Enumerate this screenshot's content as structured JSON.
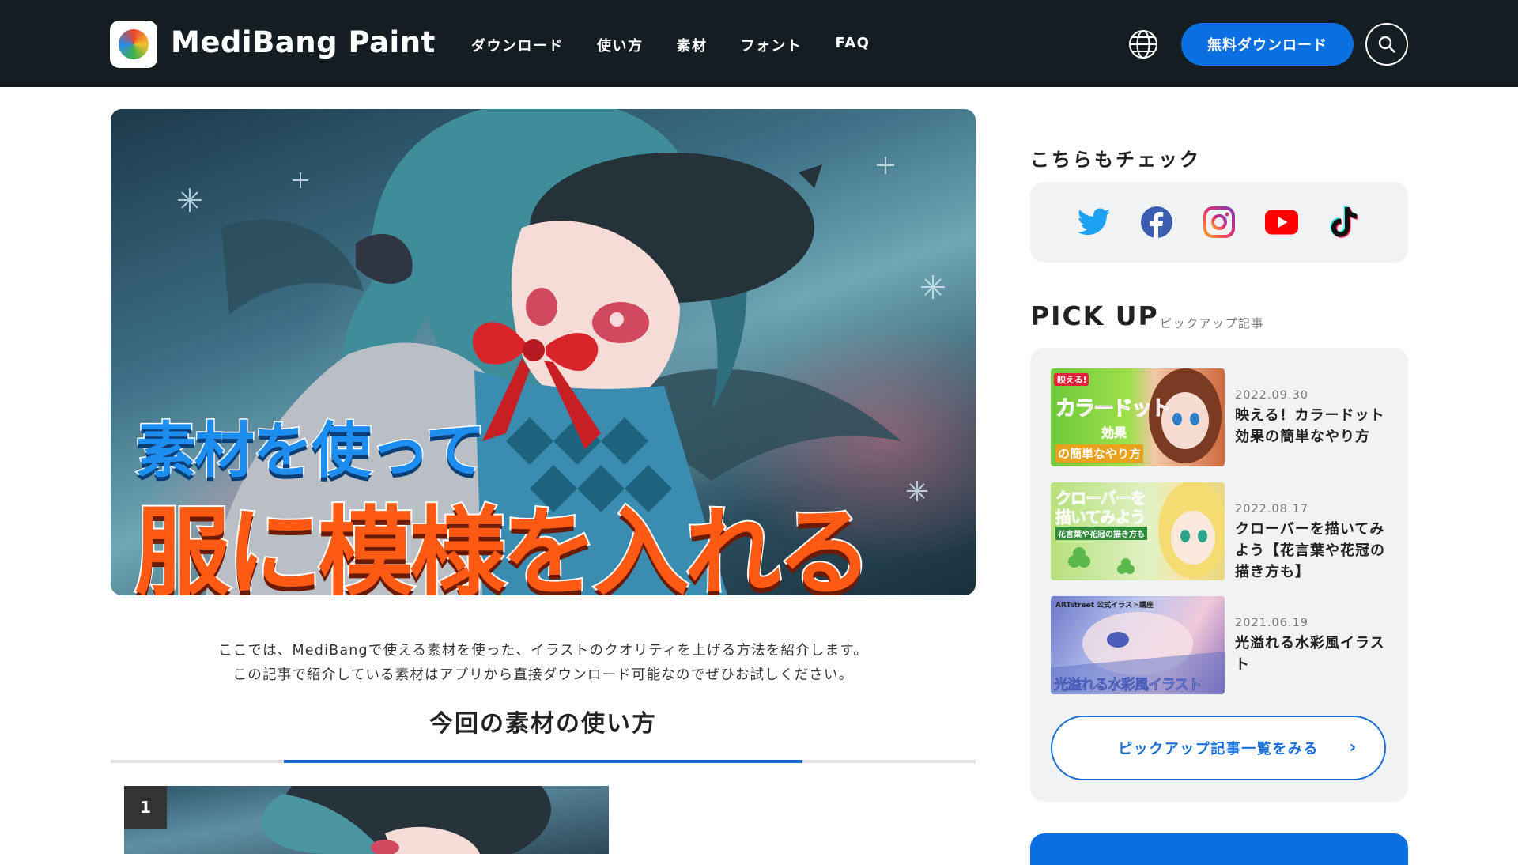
{
  "header": {
    "brand": "MediBang Paint",
    "nav": [
      "ダウンロード",
      "使い方",
      "素材",
      "フォント",
      "FAQ"
    ],
    "download_label": "無料ダウンロード"
  },
  "hero": {
    "line1": "素材を使って",
    "line2": "服に模様を入れる"
  },
  "intro": {
    "line1": "ここでは、MediBangで使える素材を使った、イラストのクオリティを上げる方法を紹介します。",
    "line2": "この記事で紹介している素材はアプリから直接ダウンロード可能なのでぜひお試しください。"
  },
  "section_title": "今回の素材の使い方",
  "step_number": "1",
  "sidebar": {
    "check_title": "こちらもチェック",
    "social": [
      "twitter-icon",
      "facebook-icon",
      "instagram-icon",
      "youtube-icon",
      "tiktok-icon"
    ],
    "pickup_title": "PICK UP",
    "pickup_sub": "ピックアップ記事",
    "articles": [
      {
        "date": "2022.09.30",
        "title": "映える！カラードット効果の簡単なやり方",
        "thumb_top": "映える!",
        "thumb_main": "カラードット",
        "thumb_main2": "効果",
        "thumb_bottom": "の簡単なやり方"
      },
      {
        "date": "2022.08.17",
        "title": "クローバーを描いてみよう【花言葉や花冠の描き方も】",
        "thumb_main": "クローバーを",
        "thumb_main2": "描いてみよう",
        "thumb_bottom": "花言葉や花冠の描き方も"
      },
      {
        "date": "2021.06.19",
        "title": "光溢れる水彩風イラスト",
        "thumb_top": "ARTstreet 公式イラスト講座",
        "thumb_bottom": "光溢れる水彩風イラスト"
      }
    ],
    "more_label": "ピックアップ記事一覧をみる"
  },
  "colors": {
    "header_bg": "#141d22",
    "accent": "#0a6fe0",
    "panel_bg": "#f1f2f4"
  }
}
